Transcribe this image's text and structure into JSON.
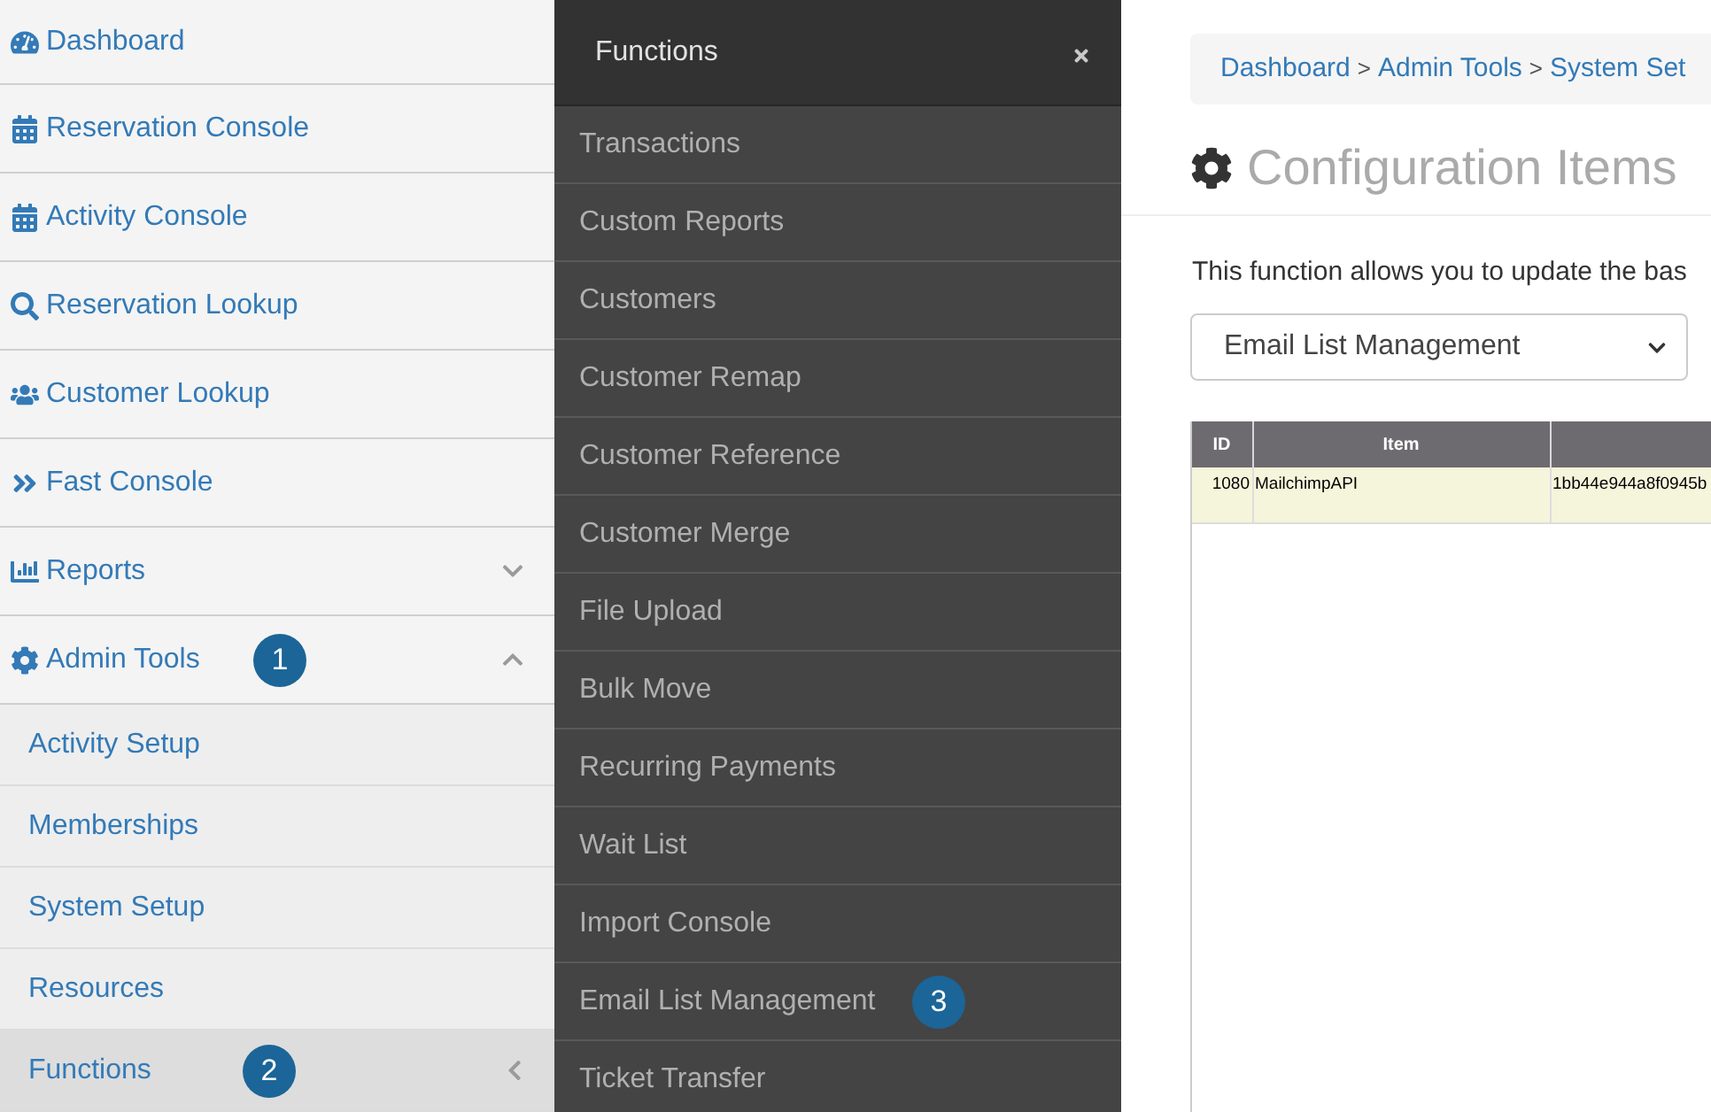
{
  "sidebar": {
    "items": [
      {
        "kind": "link",
        "label": "Dashboard"
      },
      {
        "kind": "link",
        "label": "Reservation Console"
      },
      {
        "kind": "link",
        "label": "Activity Console"
      },
      {
        "kind": "link",
        "label": "Reservation Lookup"
      },
      {
        "kind": "link",
        "label": "Customer Lookup"
      },
      {
        "kind": "link",
        "label": "Fast Console"
      },
      {
        "kind": "group",
        "label": "Reports",
        "expanded": false
      },
      {
        "kind": "group",
        "label": "Admin Tools",
        "expanded": true,
        "badge": "1",
        "children": [
          {
            "label": "Activity Setup",
            "selected": false
          },
          {
            "label": "Memberships",
            "selected": false
          },
          {
            "label": "System Setup",
            "selected": false
          },
          {
            "label": "Resources",
            "selected": false
          },
          {
            "label": "Functions",
            "selected": true,
            "badge": "2"
          }
        ]
      }
    ]
  },
  "functions_panel": {
    "title": "Functions",
    "items": [
      {
        "label": "Transactions"
      },
      {
        "label": "Custom Reports"
      },
      {
        "label": "Customers"
      },
      {
        "label": "Customer Remap"
      },
      {
        "label": "Customer Reference"
      },
      {
        "label": "Customer Merge"
      },
      {
        "label": "File Upload"
      },
      {
        "label": "Bulk Move"
      },
      {
        "label": "Recurring Payments"
      },
      {
        "label": "Wait List"
      },
      {
        "label": "Import Console"
      },
      {
        "label": "Email List Management",
        "badge": "3"
      },
      {
        "label": "Ticket Transfer"
      }
    ]
  },
  "main": {
    "breadcrumb": {
      "items": [
        "Dashboard",
        "Admin Tools",
        "System Set"
      ],
      "separators": [
        ">",
        ">"
      ]
    },
    "title": "Configuration Items",
    "description": "This function allows you to update the bas",
    "select": {
      "value": "Email List Management"
    },
    "table": {
      "columns": [
        "ID",
        "Item"
      ],
      "rows": [
        {
          "cells": [
            "1080",
            "MailchimpAPI",
            "1bb44e944a8f0945b"
          ]
        }
      ]
    }
  }
}
